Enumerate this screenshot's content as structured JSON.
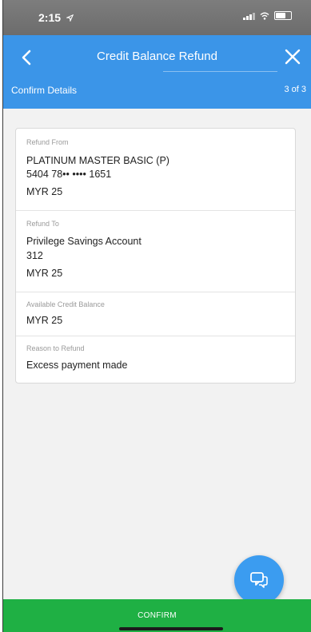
{
  "status_bar": {
    "time": "2:15",
    "location_icon": "location-arrow-icon",
    "signal_icon": "signal-icon",
    "wifi_icon": "wifi-icon",
    "battery_icon": "battery-icon"
  },
  "header": {
    "title": "Credit Balance Refund",
    "back_icon": "chevron-left-icon",
    "close_icon": "close-icon",
    "step_label": "Confirm Details",
    "step_count": "3 of 3"
  },
  "details": {
    "refund_from": {
      "label": "Refund From",
      "card_name": "PLATINUM MASTER BASIC (P)",
      "card_number": "5404 78•• •••• 1651",
      "amount": "MYR 25"
    },
    "refund_to": {
      "label": "Refund To",
      "account_name": "Privilege Savings Account",
      "account_number": "312",
      "amount": "MYR 25"
    },
    "available_balance": {
      "label": "Available Credit Balance",
      "amount": "MYR 25"
    },
    "reason": {
      "label": "Reason to Refund",
      "value": "Excess payment made"
    }
  },
  "chat": {
    "icon": "chat-icon"
  },
  "footer": {
    "confirm_label": "CONFIRM"
  },
  "colors": {
    "header_blue": "#3b95e8",
    "confirm_green": "#1fb044",
    "status_gray": "#757575"
  }
}
